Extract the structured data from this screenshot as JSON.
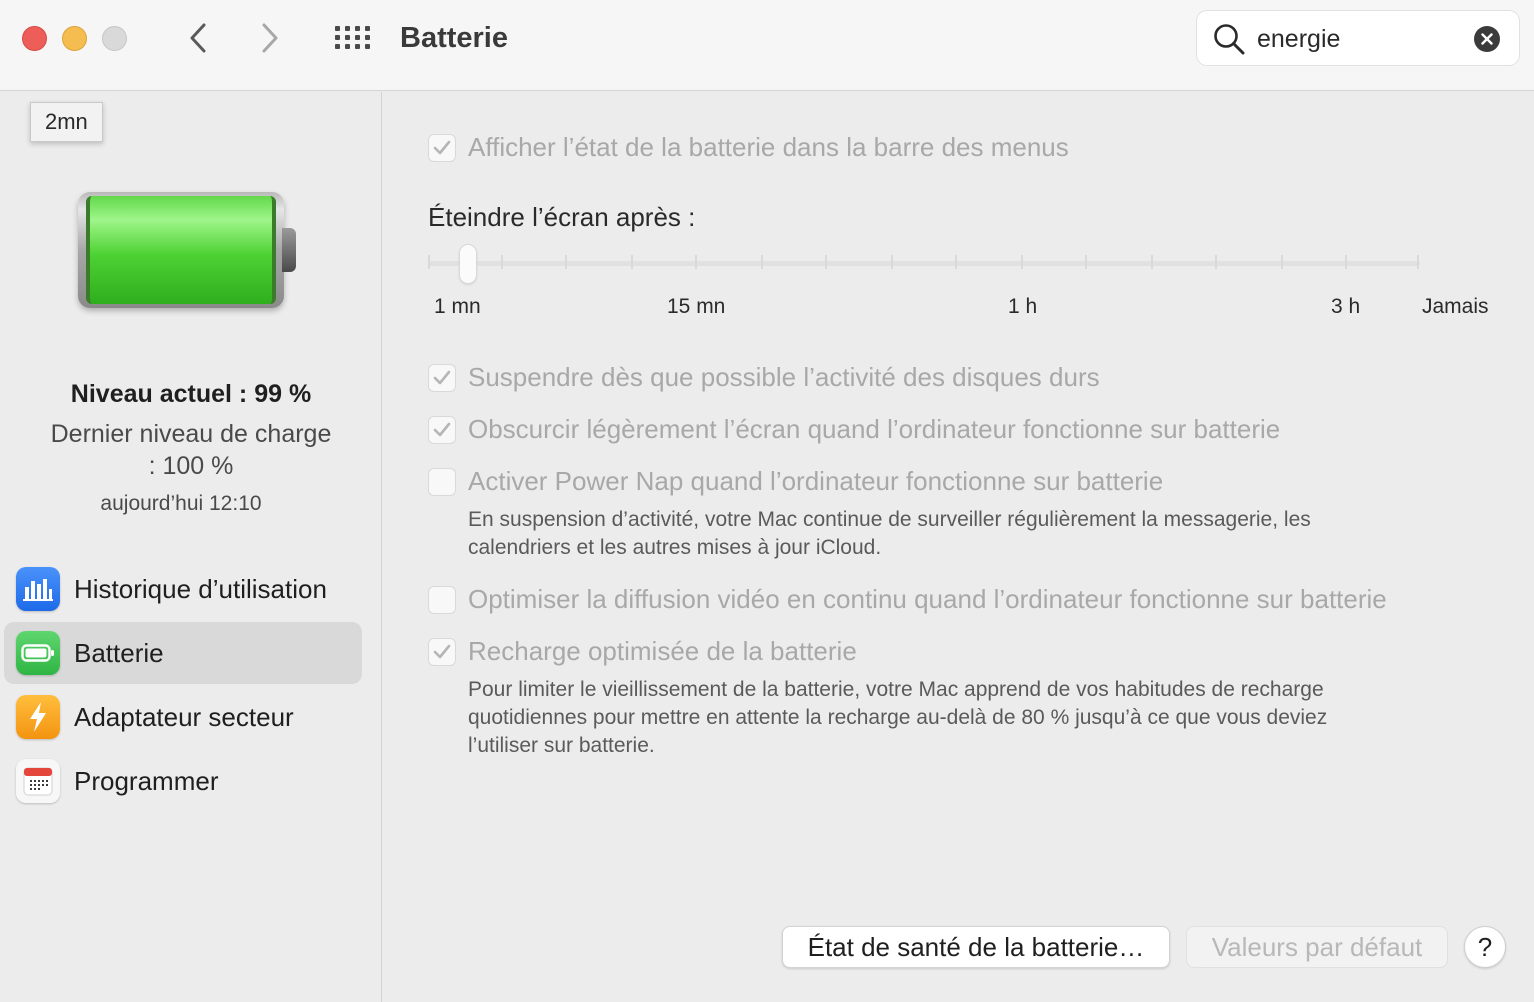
{
  "window": {
    "title": "Batterie",
    "search_value": "energie",
    "icons": {
      "close": "close-button",
      "minimize": "minimize-button",
      "zoom": "zoom-button-disabled",
      "back": "chevron-left-icon",
      "forward": "chevron-right-icon",
      "show_all": "grid-icon",
      "search": "magnifier-icon",
      "clear": "clear-search-icon"
    }
  },
  "sidebar": {
    "tooltip": "2mn",
    "battery": {
      "current_level": "Niveau actuel : 99 %",
      "current_level_fraction": 0.99,
      "last_charge": "Dernier niveau de charge : 100 %",
      "last_charge_time": "aujourd’hui 12:10"
    },
    "items": [
      {
        "label": "Historique d’utilisation",
        "icon": "usage-history-icon",
        "icon_color": "#2f7cf6",
        "selected": false
      },
      {
        "label": "Batterie",
        "icon": "battery-icon",
        "icon_color": "#34c759",
        "selected": true
      },
      {
        "label": "Adaptateur secteur",
        "icon": "power-adapter-icon",
        "icon_color": "#f7a30c",
        "selected": false
      },
      {
        "label": "Programmer",
        "icon": "calendar-schedule-icon",
        "icon_color": "#e5463c",
        "selected": false
      }
    ]
  },
  "main": {
    "show_in_menu_bar": {
      "label": "Afficher l’état de la batterie dans la barre des menus",
      "checked": true
    },
    "display_off": {
      "label": "Éteindre l’écran après :",
      "value": "2 mn",
      "tick_labels": [
        "1 mn",
        "15 mn",
        "1 h",
        "3 h",
        "Jamais"
      ]
    },
    "options": [
      {
        "label": "Suspendre dès que possible l’activité des disques durs",
        "checked": true
      },
      {
        "label": "Obscurcir légèrement l’écran quand l’ordinateur fonctionne sur batterie",
        "checked": true
      },
      {
        "label": "Activer Power Nap quand l’ordinateur fonctionne sur batterie",
        "checked": false
      },
      {
        "label": "Optimiser la diffusion vidéo en continu quand l’ordinateur fonctionne sur batterie",
        "checked": false
      },
      {
        "label": "Recharge optimisée de la batterie",
        "checked": true
      }
    ],
    "power_nap_description_1": "En suspension d’activité, votre Mac continue de surveiller régulièrement la messagerie, les",
    "power_nap_description_2": "calendriers et les autres mises à jour iCloud.",
    "optimized_charging_description_1": "Pour limiter le vieillissement de la batterie, votre Mac apprend de vos habitudes de recharge",
    "optimized_charging_description_2": "quotidiennes pour mettre en attente la recharge au-delà de 80 % jusqu’à ce que vous deviez",
    "optimized_charging_description_3": "l’utiliser sur batterie.",
    "buttons": {
      "battery_health": "État de santé de la batterie…",
      "defaults": "Valeurs par défaut",
      "help": "?"
    },
    "accent_color": "#a8a8a8"
  }
}
